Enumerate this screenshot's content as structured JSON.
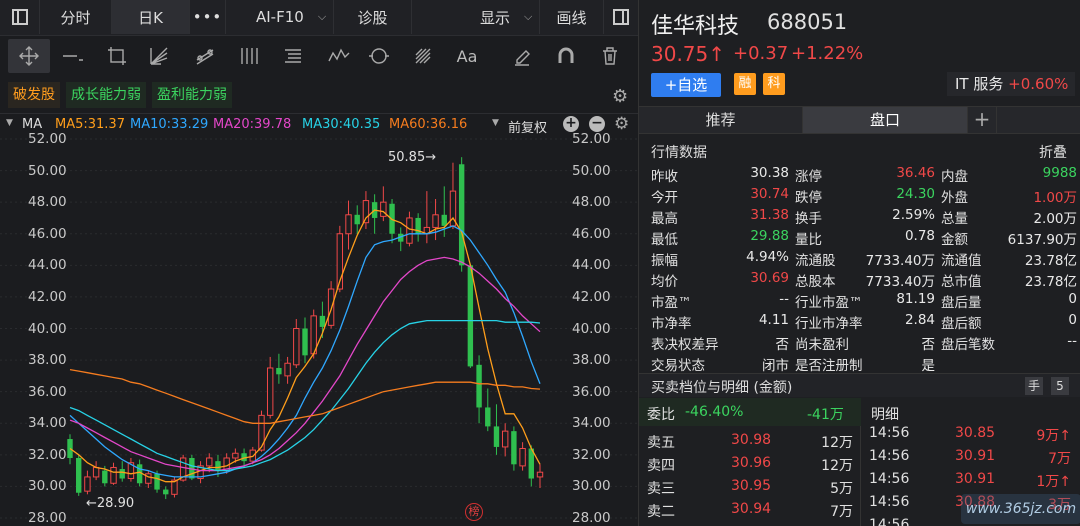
{
  "toolbar": {
    "fenshi": "分时",
    "rik": "日K",
    "more": "•••",
    "f10": "AI-F10",
    "zhengu": "诊股",
    "display": "显示",
    "draw": "画线"
  },
  "tags": [
    "破发股",
    "成长能力弱",
    "盈利能力弱"
  ],
  "ma": {
    "label": "MA",
    "ma5": "MA5:31.37",
    "ma10": "MA10:33.29",
    "ma20": "MA20:39.78",
    "ma30": "MA30:40.35",
    "ma60": "MA60:36.16",
    "adjust": "前复权"
  },
  "colors": {
    "ma5": "#ff9e1b",
    "ma10": "#2fa8ff",
    "ma20": "#e347c9",
    "ma30": "#27d2e6",
    "ma60": "#f57c1f",
    "up": "#f04848",
    "down": "#2fbf4f"
  },
  "chart_data": {
    "type": "candlestick",
    "ylim": [
      28,
      52
    ],
    "yticks": [
      "52.00",
      "50.00",
      "48.00",
      "46.00",
      "44.00",
      "42.00",
      "40.00",
      "38.00",
      "36.00",
      "34.00",
      "32.00",
      "30.00",
      "28.00"
    ],
    "annotations": {
      "high": "50.85→",
      "low": "←28.90"
    },
    "candles": [
      [
        33.0,
        31.8,
        33.3,
        31.4
      ],
      [
        31.8,
        29.6,
        32.0,
        29.4
      ],
      [
        29.7,
        30.6,
        31.0,
        29.5
      ],
      [
        30.6,
        31.2,
        31.6,
        30.4
      ],
      [
        31.0,
        30.2,
        31.3,
        30.0
      ],
      [
        30.2,
        31.2,
        31.5,
        30.1
      ],
      [
        31.1,
        30.5,
        31.6,
        30.3
      ],
      [
        30.5,
        31.5,
        31.8,
        30.3
      ],
      [
        31.4,
        30.2,
        31.7,
        30.0
      ],
      [
        30.2,
        30.8,
        31.0,
        29.9
      ],
      [
        30.8,
        29.8,
        31.0,
        29.6
      ],
      [
        29.8,
        29.5,
        30.0,
        29.2
      ],
      [
        29.5,
        30.4,
        30.6,
        29.3
      ],
      [
        30.4,
        31.8,
        32.0,
        30.3
      ],
      [
        31.8,
        30.5,
        32.0,
        30.4
      ],
      [
        30.5,
        31.3,
        31.6,
        30.2
      ],
      [
        31.3,
        31.8,
        32.1,
        30.9
      ],
      [
        31.6,
        31.0,
        32.0,
        30.6
      ],
      [
        31.0,
        31.8,
        32.1,
        30.8
      ],
      [
        31.8,
        32.1,
        32.4,
        31.5
      ],
      [
        32.1,
        31.6,
        32.4,
        31.2
      ],
      [
        31.6,
        32.3,
        32.5,
        31.4
      ],
      [
        32.3,
        34.5,
        34.8,
        32.2
      ],
      [
        34.5,
        37.5,
        38.2,
        34.3
      ],
      [
        37.5,
        37.1,
        38.4,
        36.5
      ],
      [
        37.0,
        37.8,
        38.2,
        36.5
      ],
      [
        37.7,
        40.0,
        40.6,
        37.5
      ],
      [
        40.0,
        38.3,
        40.7,
        37.8
      ],
      [
        38.4,
        40.8,
        41.2,
        38.1
      ],
      [
        40.8,
        40.1,
        41.7,
        39.4
      ],
      [
        40.2,
        42.5,
        43.0,
        40.0
      ],
      [
        42.5,
        46.0,
        46.5,
        42.3
      ],
      [
        46.0,
        47.2,
        48.1,
        45.0
      ],
      [
        47.2,
        46.6,
        47.8,
        46.0
      ],
      [
        46.7,
        48.1,
        48.7,
        46.3
      ],
      [
        48.0,
        47.0,
        48.5,
        46.0
      ],
      [
        47.1,
        48.0,
        49.0,
        46.8
      ],
      [
        47.9,
        46.0,
        48.2,
        45.4
      ],
      [
        46.0,
        45.5,
        46.4,
        44.9
      ],
      [
        45.4,
        47.0,
        47.4,
        45.2
      ],
      [
        47.0,
        46.0,
        47.3,
        45.5
      ],
      [
        46.0,
        46.4,
        48.7,
        45.4
      ],
      [
        46.4,
        47.2,
        48.2,
        45.6
      ],
      [
        47.2,
        46.5,
        49.0,
        45.8
      ],
      [
        46.5,
        48.7,
        50.5,
        46.3
      ],
      [
        50.4,
        44.0,
        50.85,
        43.6
      ],
      [
        44.0,
        37.6,
        44.1,
        37.5
      ],
      [
        37.7,
        35.0,
        38.3,
        34.0
      ],
      [
        35.0,
        33.8,
        36.2,
        33.5
      ],
      [
        33.8,
        32.5,
        35.2,
        32.0
      ],
      [
        32.5,
        33.5,
        34.0,
        31.9
      ],
      [
        33.5,
        31.4,
        33.8,
        31.0
      ],
      [
        31.3,
        32.4,
        32.8,
        31.0
      ],
      [
        32.4,
        30.5,
        32.6,
        30.0
      ],
      [
        30.6,
        30.9,
        31.4,
        29.9
      ]
    ],
    "ma": {
      "MA5": [
        32.4,
        32.0,
        31.5,
        31.2,
        31.1,
        30.9,
        30.9,
        30.8,
        30.9,
        30.6,
        30.5,
        30.3,
        30.3,
        30.6,
        30.8,
        31.0,
        31.2,
        31.2,
        31.3,
        31.6,
        31.8,
        31.9,
        32.5,
        33.6,
        34.4,
        35.6,
        36.9,
        37.6,
        38.4,
        39.7,
        41.2,
        43.0,
        44.5,
        45.9,
        47.0,
        47.5,
        47.4,
        46.9,
        46.7,
        46.3,
        46.2,
        46.0,
        46.3,
        46.4,
        47.0,
        46.1,
        44.0,
        41.3,
        38.7,
        36.5,
        34.6,
        34.6,
        33.7,
        32.4,
        31.4
      ],
      "MA10": [
        34.5,
        34.0,
        33.5,
        33.0,
        32.5,
        32.1,
        31.7,
        31.4,
        31.1,
        31.0,
        30.8,
        30.7,
        30.6,
        30.6,
        30.6,
        30.6,
        30.7,
        30.8,
        30.9,
        31.1,
        31.3,
        31.5,
        31.9,
        32.4,
        33.0,
        33.7,
        34.5,
        35.6,
        36.6,
        37.5,
        38.6,
        39.9,
        41.4,
        43.0,
        44.5,
        45.3,
        45.5,
        45.6,
        45.8,
        46.0,
        46.0,
        46.0,
        46.1,
        46.3,
        46.5,
        46.2,
        45.6,
        44.8,
        44.0,
        43.1,
        42.3,
        41.0,
        39.5,
        37.9,
        36.5
      ],
      "MA20": [
        34.2,
        34.0,
        33.7,
        33.4,
        33.1,
        32.8,
        32.5,
        32.2,
        32.0,
        31.8,
        31.6,
        31.4,
        31.3,
        31.2,
        31.1,
        31.0,
        31.0,
        31.0,
        31.1,
        31.2,
        31.3,
        31.5,
        31.7,
        32.0,
        32.4,
        32.9,
        33.4,
        34.0,
        34.7,
        35.4,
        36.2,
        37.0,
        38.0,
        39.0,
        39.9,
        40.8,
        41.7,
        42.4,
        43.1,
        43.6,
        44.0,
        44.3,
        44.4,
        44.5,
        44.4,
        44.2,
        43.9,
        43.5,
        43.0,
        42.5,
        41.9,
        41.4,
        40.8,
        40.3,
        39.8
      ],
      "MA30": [
        35.0,
        34.8,
        34.5,
        34.2,
        33.9,
        33.6,
        33.3,
        33.0,
        32.7,
        32.4,
        32.1,
        31.9,
        31.7,
        31.5,
        31.3,
        31.2,
        31.1,
        31.0,
        31.0,
        31.1,
        31.2,
        31.3,
        31.5,
        31.7,
        32.0,
        32.3,
        32.7,
        33.1,
        33.6,
        34.2,
        34.8,
        35.5,
        36.2,
        37.0,
        37.8,
        38.5,
        39.1,
        39.6,
        40.0,
        40.3,
        40.4,
        40.5,
        40.5,
        40.5,
        40.5,
        40.5,
        40.5,
        40.5,
        40.5,
        40.5,
        40.4,
        40.4,
        40.4,
        40.4,
        40.35
      ],
      "MA60": [
        37.4,
        37.3,
        37.2,
        37.1,
        37.0,
        36.9,
        36.8,
        36.6,
        36.5,
        36.3,
        36.1,
        35.9,
        35.7,
        35.5,
        35.3,
        35.1,
        34.9,
        34.7,
        34.5,
        34.3,
        34.1,
        34.0,
        34.0,
        34.0,
        34.1,
        34.2,
        34.3,
        34.4,
        34.5,
        34.6,
        34.8,
        35.0,
        35.2,
        35.4,
        35.6,
        35.8,
        36.0,
        36.1,
        36.2,
        36.3,
        36.4,
        36.5,
        36.6,
        36.6,
        36.6,
        36.6,
        36.6,
        36.5,
        36.5,
        36.4,
        36.4,
        36.3,
        36.3,
        36.2,
        36.16
      ]
    }
  },
  "stock": {
    "name": "佳华科技",
    "code": "688051",
    "price": "30.75↑",
    "change": "+0.37",
    "pct": "+1.22%",
    "add": "+自选",
    "rong": "融",
    "ke": "科",
    "industry": "IT 服务",
    "industry_pct": "+0.60%"
  },
  "tabs": {
    "tuijian": "推荐",
    "pankou": "盘口",
    "plus": "+"
  },
  "quote": {
    "title": "行情数据",
    "fold": "折叠",
    "rows": [
      [
        {
          "l": "昨收",
          "v": "30.38",
          "c": "white"
        },
        {
          "l": "涨停",
          "v": "36.46",
          "c": "red"
        },
        {
          "l": "内盘",
          "v": "9988",
          "c": "green"
        }
      ],
      [
        {
          "l": "今开",
          "v": "30.74",
          "c": "red"
        },
        {
          "l": "跌停",
          "v": "24.30",
          "c": "green"
        },
        {
          "l": "外盘",
          "v": "1.00万",
          "c": "red"
        }
      ],
      [
        {
          "l": "最高",
          "v": "31.38",
          "c": "red"
        },
        {
          "l": "换手",
          "v": "2.59%",
          "c": "white"
        },
        {
          "l": "总量",
          "v": "2.00万",
          "c": "white"
        }
      ],
      [
        {
          "l": "最低",
          "v": "29.88",
          "c": "green"
        },
        {
          "l": "量比",
          "v": "0.78",
          "c": "white"
        },
        {
          "l": "金额",
          "v": "6137.90万",
          "c": "white"
        }
      ],
      [
        {
          "l": "振幅",
          "v": "4.94%",
          "c": "white"
        },
        {
          "l": "流通股",
          "v": "7733.40万",
          "c": "white"
        },
        {
          "l": "流通值",
          "v": "23.78亿",
          "c": "white"
        }
      ],
      [
        {
          "l": "均价",
          "v": "30.69",
          "c": "red"
        },
        {
          "l": "总股本",
          "v": "7733.40万",
          "c": "white"
        },
        {
          "l": "总市值",
          "v": "23.78亿",
          "c": "white"
        }
      ],
      [
        {
          "l": "市盈™",
          "v": "--",
          "c": "white"
        },
        {
          "l": "行业市盈™",
          "v": "81.19",
          "c": "white"
        },
        {
          "l": "盘后量",
          "v": "0",
          "c": "white"
        }
      ],
      [
        {
          "l": "市净率",
          "v": "4.11",
          "c": "white"
        },
        {
          "l": "行业市净率",
          "v": "2.84",
          "c": "white"
        },
        {
          "l": "盘后额",
          "v": "0",
          "c": "white"
        }
      ],
      [
        {
          "l": "表决权差异",
          "v": "否",
          "c": "white"
        },
        {
          "l": "尚未盈利",
          "v": "否",
          "c": "white"
        },
        {
          "l": "盘后笔数",
          "v": "--",
          "c": "white"
        }
      ],
      [
        {
          "l": "交易状态",
          "v": "闭市",
          "c": "white"
        },
        {
          "l": "是否注册制",
          "v": "是",
          "c": "white"
        },
        {
          "l": "",
          "v": "",
          "c": "white"
        }
      ]
    ]
  },
  "orderbook": {
    "title": "买卖档位与明细 (金额)",
    "shou": "手",
    "five": "5",
    "weibi_label": "委比",
    "weibi": "-46.40%",
    "weicha": "-41万",
    "mingxi": "明细",
    "asks": [
      {
        "l": "卖五",
        "p": "30.98",
        "v": "12万"
      },
      {
        "l": "卖四",
        "p": "30.96",
        "v": "12万"
      },
      {
        "l": "卖三",
        "p": "30.95",
        "v": "5万"
      },
      {
        "l": "卖二",
        "p": "30.94",
        "v": "7万"
      }
    ],
    "ticks": [
      {
        "t": "14:56",
        "p": "30.85",
        "v": "9万↑"
      },
      {
        "t": "14:56",
        "p": "30.91",
        "v": "7万"
      },
      {
        "t": "14:56",
        "p": "30.91",
        "v": "1万↑"
      },
      {
        "t": "14:56",
        "p": "30.88",
        "v": "3万"
      },
      {
        "t": "14:56",
        "p": "",
        "v": ""
      }
    ]
  },
  "watermark": "www.365jz.com",
  "bang": "榜"
}
